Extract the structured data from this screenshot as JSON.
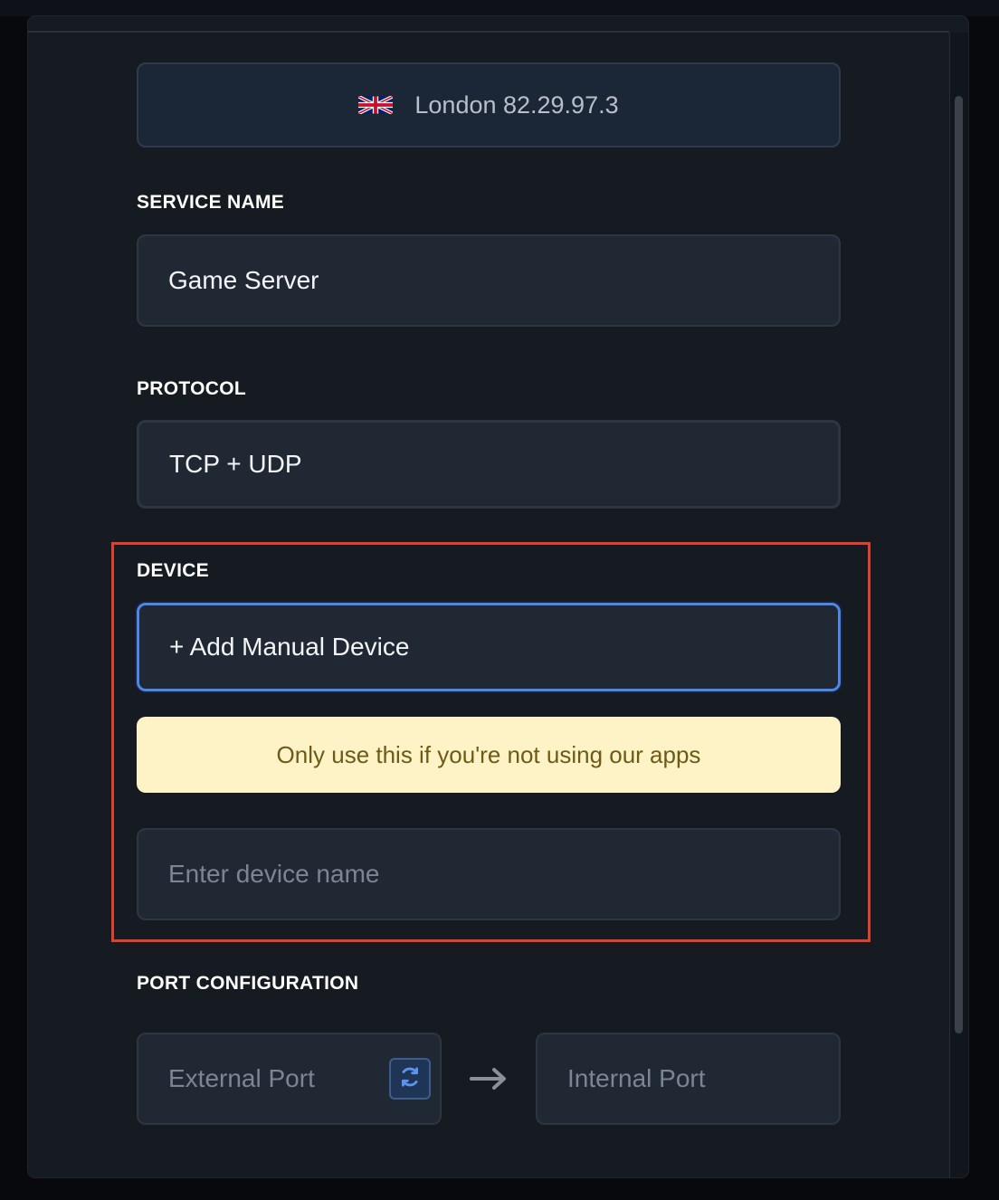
{
  "location": {
    "flag_icon": "uk-flag-icon",
    "text": "London 82.29.97.3"
  },
  "service_name": {
    "label": "SERVICE NAME",
    "value": "Game Server"
  },
  "protocol": {
    "label": "PROTOCOL",
    "value": "TCP + UDP"
  },
  "device": {
    "label": "DEVICE",
    "selected": "+ Add Manual Device",
    "warning": "Only use this if you're not using our apps",
    "name_placeholder": "Enter device name"
  },
  "port_configuration": {
    "label": "PORT CONFIGURATION",
    "external_placeholder": "External Port",
    "internal_placeholder": "Internal Port",
    "refresh_icon": "refresh-icon",
    "arrow_icon": "arrow-right-icon"
  },
  "colors": {
    "accent": "#4f86e8",
    "highlight": "#e0402e",
    "warning_bg": "#fdf3c6",
    "warning_text": "#6e5a17",
    "modal_bg": "#161b22"
  }
}
